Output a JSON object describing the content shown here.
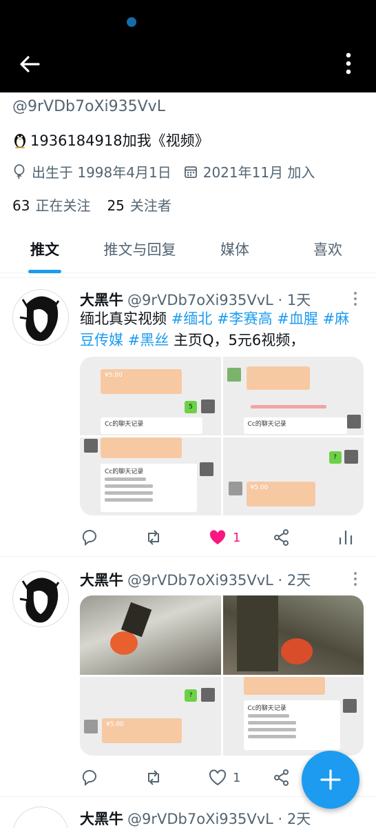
{
  "profile": {
    "handle": "@9rVDb7oXi935VvL",
    "bio": "1936184918加我《视频》",
    "born": "出生于 1998年4月1日",
    "joined": "2021年11月 加入",
    "following_count": "63",
    "following_label": "正在关注",
    "followers_count": "25",
    "followers_label": "关注者"
  },
  "tabs": [
    {
      "label": "推文"
    },
    {
      "label": "推文与回复"
    },
    {
      "label": "媒体"
    },
    {
      "label": "喜欢"
    }
  ],
  "tweets": [
    {
      "name": "大黑牛",
      "meta": "@9rVDb7oXi935VvL · 1天",
      "text_plain_1": "缅北真实视频 ",
      "tag_1": "#缅北",
      "tag_2": "#李赛高",
      "tag_3": "#血腥",
      "tag_4": "#麻豆传媒",
      "tag_5": "#黑丝",
      "text_plain_2": " 主页Q，5元6视频，",
      "like_count": "1"
    },
    {
      "name": "大黑牛",
      "meta": "@9rVDb7oXi935VvL · 2天",
      "reply_like_count": "1"
    },
    {
      "name": "大黑牛",
      "meta": "@9rVDb7oXi935VvL · 2天"
    }
  ],
  "thumbs": {
    "chat_title": "Cc的聊天记录",
    "amount": "¥5.00",
    "q": "?",
    "five": "5"
  },
  "colors": {
    "accent": "#1d9bf0",
    "like": "#f91880"
  }
}
